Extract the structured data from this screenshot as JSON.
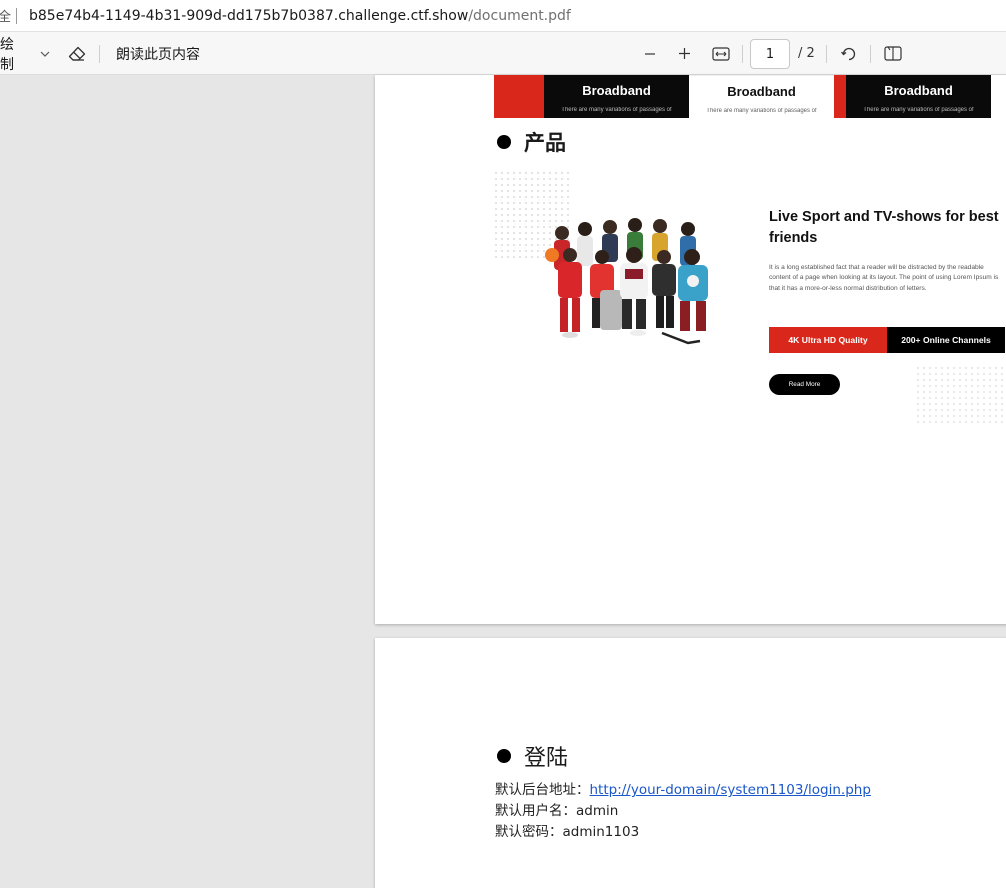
{
  "address_bar": {
    "secure_fragment": "全",
    "host": "b85e74b4-1149-4b31-909d-dd175b7b0387.challenge.ctf.show",
    "path": "/document.pdf"
  },
  "toolbar": {
    "draw_label": "绘制",
    "read_aloud_label": "朗读此页内容",
    "page_current": "1",
    "page_total": "/ 2",
    "icons": [
      "chevron-down-icon",
      "eraser-icon",
      "zoom-out-icon",
      "zoom-in-icon",
      "fit-page-icon",
      "rotate-icon",
      "two-page-icon"
    ]
  },
  "page1": {
    "banner": {
      "cards": [
        {
          "title": "Broadband",
          "sub": "There are many variations of passages of"
        },
        {
          "title": "Broadband",
          "sub": "There are many variations of passages of"
        },
        {
          "title": "Broadband",
          "sub": "There are many variations of passages of"
        }
      ]
    },
    "products_heading": "产品",
    "product": {
      "title": "Live Sport and TV-shows for best friends",
      "description": "It is a long established fact that a reader will be distracted by the readable content of a page when looking at its layout. The point of using Lorem Ipsum is that it has a more-or-less normal distribution of letters.",
      "feature_red": "4K Ultra HD Quality",
      "feature_black": "200+ Online Channels",
      "read_more": "Read More"
    },
    "colors": {
      "accent": "#d9281b",
      "dark": "#0a0a0a"
    }
  },
  "page2": {
    "login_heading": "登陆",
    "url_label": "默认后台地址：",
    "url": "http://your-domain/system1103/login.php",
    "user_label": "默认用户名：",
    "user": "admin",
    "pass_label": "默认密码：",
    "pass": "admin1103"
  }
}
